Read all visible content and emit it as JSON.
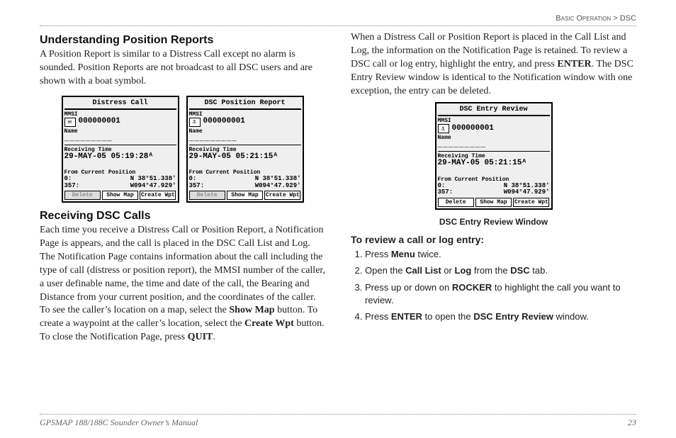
{
  "header": {
    "breadcrumb_left": "Basic Operation",
    "breadcrumb_sep": ">",
    "breadcrumb_right": "DSC"
  },
  "left": {
    "h1": "Understanding Position Reports",
    "p1": "A Position Report is similar to a Distress Call except no alarm is sounded. Position Reports are not broadcast to all DSC users and are shown with a boat symbol.",
    "h2": "Receiving DSC Calls",
    "p2a": "Each time you receive a Distress Call or Position Report, a Notification Page is appears, and the call is placed in the DSC Call List and Log. The Notification Page contains information about the call including the type of call (distress or position report), the MMSI number of the caller, a user definable name, the time and date of the call, the Bearing and Distance from your current position, and the coordinates of the caller. To see the caller’s location on a map, select the ",
    "p2_showmap": "Show Map",
    "p2b": " button. To create a waypoint at the caller’s location, select the ",
    "p2_createwpt": "Create Wpt",
    "p2c": " button. To close the Notification Page, press ",
    "p2_quit": "QUIT",
    "p2d": "."
  },
  "right": {
    "p1a": "When a Distress Call or Position Report is placed in the Call List and Log, the information on the Notification Page is retained. To review a DSC call or log entry, highlight the entry, and press ",
    "p1_enter": "ENTER",
    "p1b": ". The DSC Entry Review window is identical to the Notification window with one exception, the entry can be deleted.",
    "caption": "DSC Entry Review Window",
    "steps_head": "To review a call or log entry:",
    "steps": [
      {
        "a": "Press ",
        "b": "Menu",
        "c": " twice."
      },
      {
        "a": "Open the ",
        "b": "Call List",
        "c": " or ",
        "d": "Log",
        "e": " from the ",
        "f": "DSC",
        "g": " tab."
      },
      {
        "a": "Press up or down on ",
        "b": "ROCKER",
        "c": " to highlight the call you want to review."
      },
      {
        "a": "Press ",
        "b": "ENTER",
        "c": " to open the ",
        "d": "DSC Entry Review",
        "e": " window."
      }
    ]
  },
  "devices": {
    "distress": {
      "title": "Distress Call",
      "icon": "✉",
      "mmsi_label": "MMSI",
      "mmsi": "000000001",
      "name_label": "Name",
      "name": "_________",
      "rt_label": "Receiving Time",
      "rt": "29-MAY-05   05:19:28ᴬ",
      "fcp_label": "From Current Position",
      "dist_l1": "0:",
      "dist_l2": "357:",
      "coord_l1": "N  38°51.338'",
      "coord_l2": "W094°47.929'",
      "btn_delete": "Delete",
      "btn_showmap": "Show Map",
      "btn_create": "Create Wpt"
    },
    "posreport": {
      "title": "DSC Position Report",
      "icon": "⚓",
      "mmsi_label": "MMSI",
      "mmsi": "000000001",
      "name_label": "Name",
      "name": "_________",
      "rt_label": "Receiving Time",
      "rt": "29-MAY-05   05:21:15ᴬ",
      "fcp_label": "From Current Position",
      "dist_l1": "0:",
      "dist_l2": "357:",
      "coord_l1": "N  38°51.338'",
      "coord_l2": "W094°47.929'",
      "btn_delete": "Delete",
      "btn_showmap": "Show Map",
      "btn_create": "Create Wpt"
    },
    "review": {
      "title": "DSC Entry Review",
      "icon": "⚓",
      "mmsi_label": "MMSI",
      "mmsi": "000000001",
      "name_label": "Name",
      "name": "_________",
      "rt_label": "Receiving Time",
      "rt": "29-MAY-05   05:21:15ᴬ",
      "fcp_label": "From Current Position",
      "dist_l1": "0:",
      "dist_l2": "357:",
      "coord_l1": "N  38°51.338'",
      "coord_l2": "W094°47.929'",
      "btn_delete": "Delete",
      "btn_showmap": "Show Map",
      "btn_create": "Create Wpt"
    }
  },
  "footer": {
    "left": "GPSMAP 188/188C Sounder Owner’s Manual\t",
    "right": "23"
  }
}
